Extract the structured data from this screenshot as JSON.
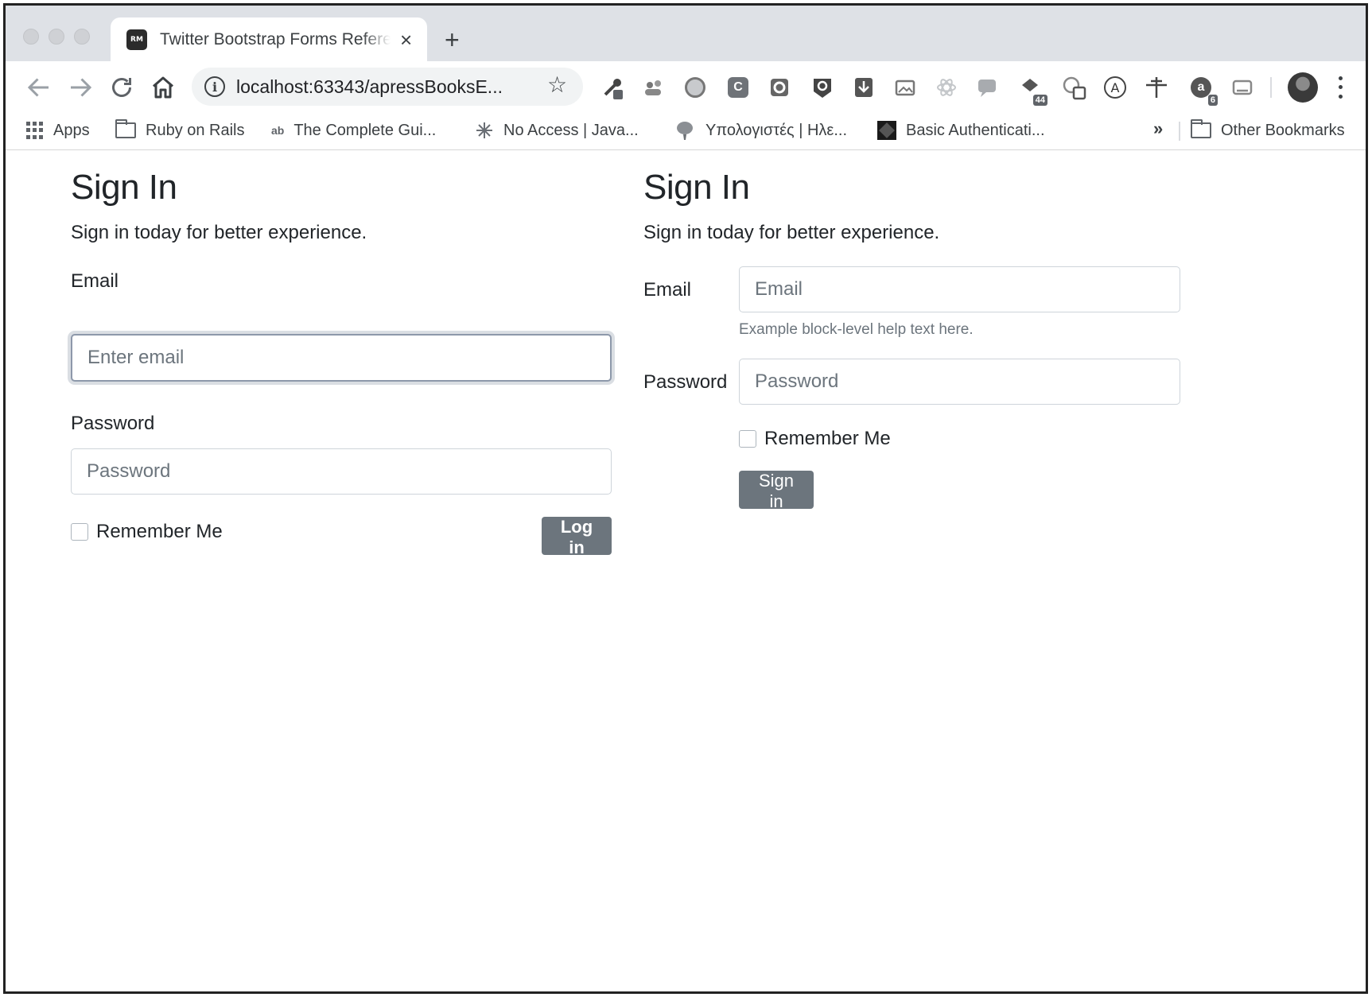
{
  "browser": {
    "tab": {
      "favicon_text": "RM",
      "title": "Twitter Bootstrap Forms Reference"
    },
    "new_tab_symbol": "+",
    "close_symbol": "×",
    "url": "localhost:63343/apressBooksE...",
    "extension_badges": {
      "ext_a": "44",
      "ext_b": "6"
    },
    "bookmarks": [
      {
        "label": "Apps",
        "icon": "apps-grid-icon"
      },
      {
        "label": "Ruby on Rails",
        "icon": "folder-icon"
      },
      {
        "label": "The Complete Gui...",
        "icon": "ab-icon"
      },
      {
        "label": "No Access | Java...",
        "icon": "sparkle-icon"
      },
      {
        "label": "Υπολογιστές | Ηλε...",
        "icon": "balloon-icon"
      },
      {
        "label": "Basic Authenticati...",
        "icon": "cube-icon"
      }
    ],
    "overflow_symbol": "»",
    "other_bookmarks": "Other Bookmarks"
  },
  "form_stacked": {
    "title": "Sign In",
    "subtitle": "Sign in today for better experience.",
    "email_label": "Email",
    "email_placeholder": "Enter email",
    "password_label": "Password",
    "password_placeholder": "Password",
    "remember_label": "Remember Me",
    "submit_label": "Log in"
  },
  "form_horizontal": {
    "title": "Sign In",
    "subtitle": "Sign in today for better experience.",
    "email_label": "Email",
    "email_placeholder": "Email",
    "email_help": "Example block-level help text here.",
    "password_label": "Password",
    "password_placeholder": "Password",
    "remember_label": "Remember Me",
    "submit_label": "Sign in"
  },
  "colors": {
    "button": "#6c757d",
    "tabstrip": "#dee1e6",
    "focus_ring": "#8d98aa"
  }
}
